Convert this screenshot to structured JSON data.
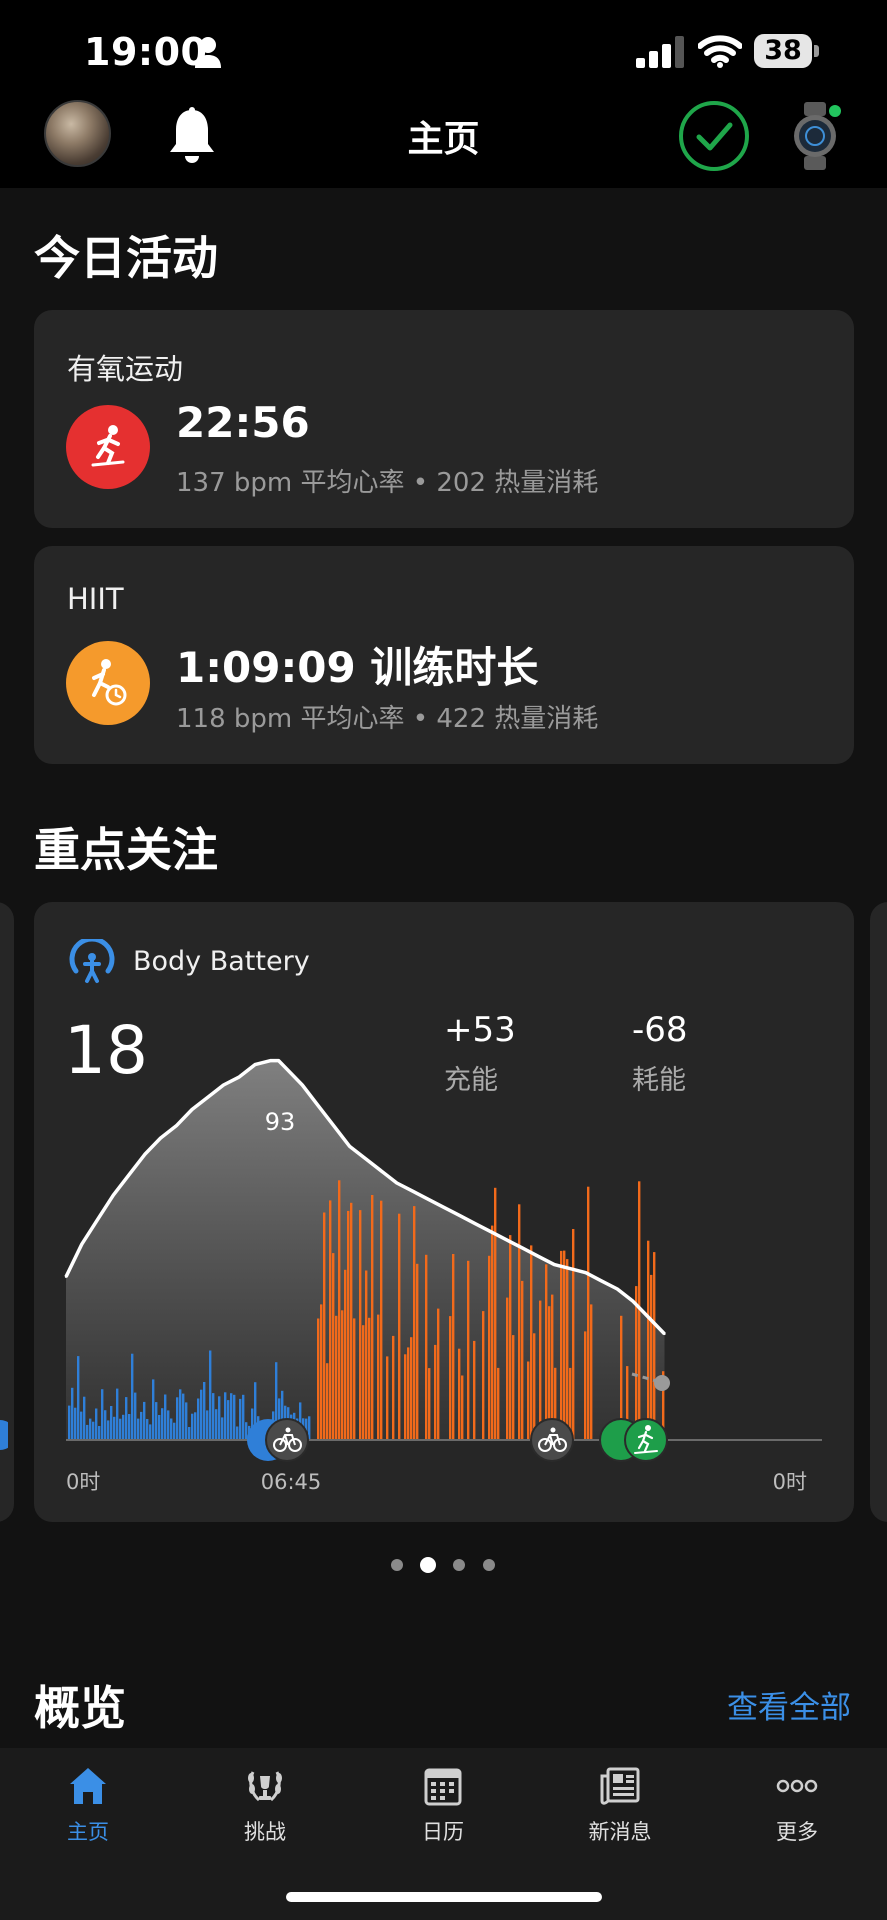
{
  "status": {
    "time": "19:00",
    "battery": "38"
  },
  "header": {
    "title": "主页"
  },
  "today": {
    "title": "今日活动",
    "activities": [
      {
        "name": "有氧运动",
        "main": "22:56",
        "sub": "137 bpm 平均心率 • 202 热量消耗",
        "color": "#e53030",
        "icon": "treadmill-runner-icon"
      },
      {
        "name": "HIIT",
        "main": "1:09:09 训练时长",
        "sub": "118 bpm 平均心率 • 422 热量消耗",
        "color": "#f59a2c",
        "icon": "hiit-timer-icon"
      }
    ]
  },
  "focus": {
    "title": "重点关注",
    "body_battery": {
      "title": "Body Battery",
      "current": "18",
      "charged": "+53",
      "charged_label": "充能",
      "drained": "-68",
      "drained_label": "耗能",
      "peak_label": "93",
      "axis_labels": {
        "start": "0时",
        "marker": "06:45",
        "end": "0时"
      },
      "colors": {
        "rest": "#2f7fd8",
        "stress": "#f26a1b",
        "line": "#ffffff",
        "activity": "#1e9e4a"
      }
    },
    "pager": {
      "count": 4,
      "active": 1
    }
  },
  "overview": {
    "title": "概览",
    "link": "查看全部"
  },
  "nav": [
    {
      "label": "主页",
      "icon": "home-icon",
      "active": true
    },
    {
      "label": "挑战",
      "icon": "laurel-trophy-icon",
      "active": false
    },
    {
      "label": "日历",
      "icon": "calendar-icon",
      "active": false
    },
    {
      "label": "新消息",
      "icon": "newsfeed-icon",
      "active": false
    },
    {
      "label": "更多",
      "icon": "more-dots-icon",
      "active": false
    }
  ],
  "chart_data": {
    "type": "area",
    "title": "Body Battery",
    "xlabel": "",
    "ylabel": "",
    "x_range": [
      "0时",
      "0时"
    ],
    "ylim": [
      0,
      100
    ],
    "series": [
      {
        "x": [
          "00:00",
          "00:30",
          "01:00",
          "01:30",
          "02:00",
          "02:30",
          "03:00",
          "03:30",
          "04:00",
          "04:30",
          "05:00",
          "05:30",
          "06:00",
          "06:30",
          "06:45",
          "07:00",
          "07:30",
          "08:00",
          "08:30",
          "09:00",
          "09:30",
          "10:00",
          "10:30",
          "11:00",
          "11:30",
          "12:00",
          "12:30",
          "13:00",
          "13:30",
          "14:00",
          "14:30",
          "15:00",
          "15:30",
          "16:00",
          "16:30",
          "17:00",
          "17:30",
          "18:00",
          "18:30",
          "19:00"
        ],
        "values": [
          40,
          48,
          54,
          60,
          65,
          70,
          74,
          77,
          81,
          84,
          87,
          89,
          92,
          93,
          93,
          91,
          87,
          82,
          77,
          72,
          69,
          66,
          63,
          61,
          59,
          57,
          55,
          53,
          51,
          49,
          47,
          45,
          43,
          42,
          41,
          39,
          37,
          34,
          30,
          26
        ]
      }
    ],
    "latest_value": 18
  }
}
